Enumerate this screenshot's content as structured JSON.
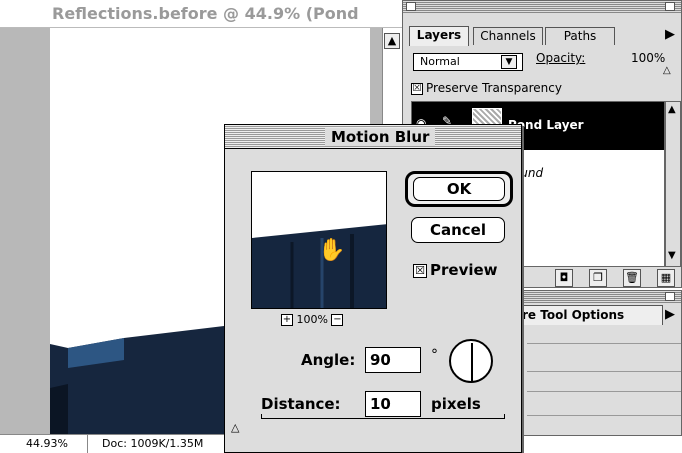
{
  "document": {
    "title": "Reflections.before @ 44.9% (Pond",
    "status": {
      "zoom": "44.93%",
      "doc_size": "Doc: 1009K/1.35M"
    }
  },
  "layers_palette": {
    "tabs": [
      "Layers",
      "Channels",
      "Paths"
    ],
    "blend_mode": "Normal",
    "opacity_label": "Opacity:",
    "opacity_value": "100%",
    "preserve_transparency": {
      "label": "Preserve Transparency",
      "checked": "☒"
    },
    "layers": [
      {
        "name": "Pond Layer",
        "selected": true
      },
      {
        "name": "Background",
        "visible_text": "round",
        "selected": false
      }
    ]
  },
  "options_palette": {
    "tab_label": "re Tool Options"
  },
  "dialog": {
    "title": "Motion Blur",
    "ok_label": "OK",
    "cancel_label": "Cancel",
    "preview_label": "Preview",
    "preview_checked": "☒",
    "zoom_level": "100%",
    "angle_label": "Angle:",
    "angle_value": "90",
    "degree_symbol": "°",
    "distance_label": "Distance:",
    "distance_value": "10",
    "distance_unit": "pixels"
  },
  "colors": {
    "image_dark_blue": "#16263e",
    "panel_gray": "#dddddd",
    "selected_layer": "#000000"
  }
}
